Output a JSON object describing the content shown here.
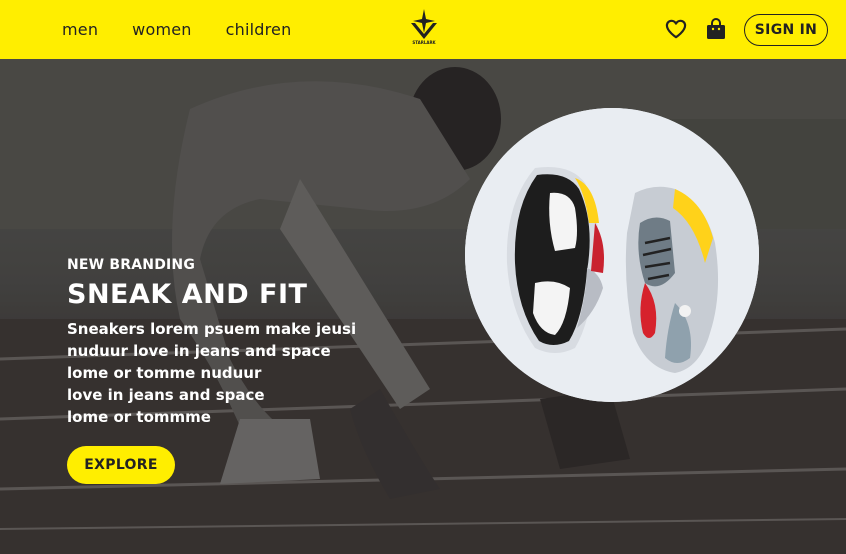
{
  "nav": {
    "links": [
      {
        "label": "men"
      },
      {
        "label": "women"
      },
      {
        "label": "children"
      }
    ]
  },
  "brand": {
    "logo_text": "STARLARK",
    "accent": "#ffee00"
  },
  "header": {
    "signin_label": "SIGN IN",
    "heart_icon": "heart-icon",
    "bag_icon": "shopping-bag-icon"
  },
  "hero": {
    "eyebrow": "NEW BRANDING",
    "headline": "SNEAK AND FIT",
    "description_lines": [
      "Sneakers lorem psuem make jeusi",
      "nuduur love in jeans and space",
      "lome or tomme nuduur",
      "love in jeans and space",
      "lome or tommme"
    ],
    "cta_label": "EXPLORE"
  }
}
